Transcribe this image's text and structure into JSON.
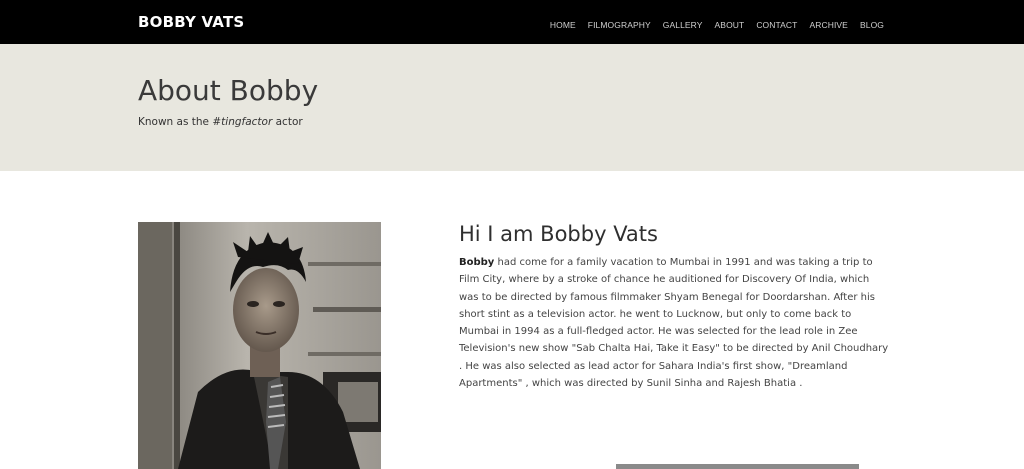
{
  "navbar": {
    "brand": "BOBBY VATS",
    "links": [
      "HOME",
      "FILMOGRAPHY",
      "GALLERY",
      "ABOUT",
      "CONTACT",
      "ARCHIVE",
      "BLOG"
    ]
  },
  "hero": {
    "title": "About Bobby",
    "subtitle_prefix": "Known as the ",
    "subtitle_tag": "#tingfactor",
    "subtitle_suffix": " actor"
  },
  "about": {
    "heading": "Hi I am Bobby Vats",
    "name_bold": "Bobby",
    "body": " had come for a family vacation to Mumbai in 1991 and was taking a trip to Film City, where by a stroke of chance he auditioned for Discovery Of India, which was to be directed by famous filmmaker Shyam Benegal for Doordarshan. After his short stint as a television actor. he went to Lucknow, but only to come back to Mumbai in 1994 as a full-fledged actor. He was selected for the lead role in Zee Television's new show \"Sab Chalta Hai, Take it Easy\" to be directed by Anil Choudhary . He was also selected as lead actor for Sahara India's first show, \"Dreamland Apartments\" , which was directed by Sunil Sinha and Rajesh Bhatia ."
  },
  "colors": {
    "navbar_bg": "#000000",
    "hero_bg": "#e8e7df",
    "page_bg": "#ffffff"
  }
}
